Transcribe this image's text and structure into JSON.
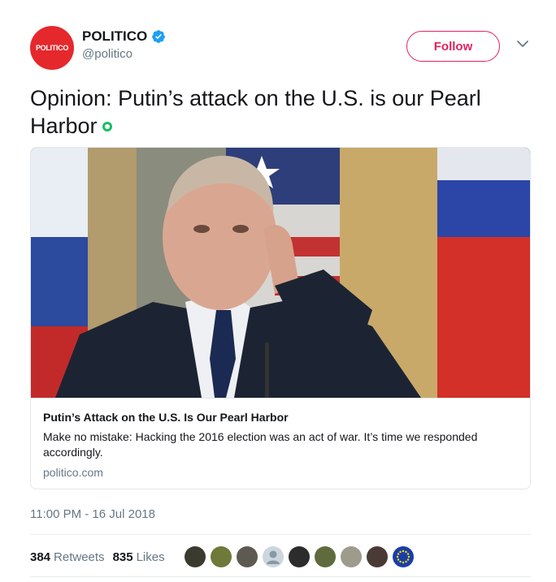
{
  "header": {
    "logo_text": "POLITICO",
    "display_name": "POLITICO",
    "handle": "@politico",
    "follow_label": "Follow",
    "verified_icon": "verified-badge-icon",
    "menu_icon": "chevron-down-icon"
  },
  "tweet": {
    "text": "Opinion: Putin’s attack on the U.S. is our Pearl Harbor"
  },
  "card": {
    "title": "Putin’s Attack on the U.S. Is Our Pearl Harbor",
    "description": "Make no mistake: Hacking the 2016 election was an act of war. It’s time we responded accordingly.",
    "domain": "politico.com"
  },
  "meta": {
    "timestamp": "11:00 PM - 16 Jul 2018"
  },
  "stats": {
    "retweets_count": "384",
    "retweets_label": "Retweets",
    "likes_count": "835",
    "likes_label": "Likes"
  },
  "colors": {
    "accent": "#e0245e",
    "brand": "#e5282c",
    "verified": "#1da1f2",
    "muted": "#657786"
  }
}
